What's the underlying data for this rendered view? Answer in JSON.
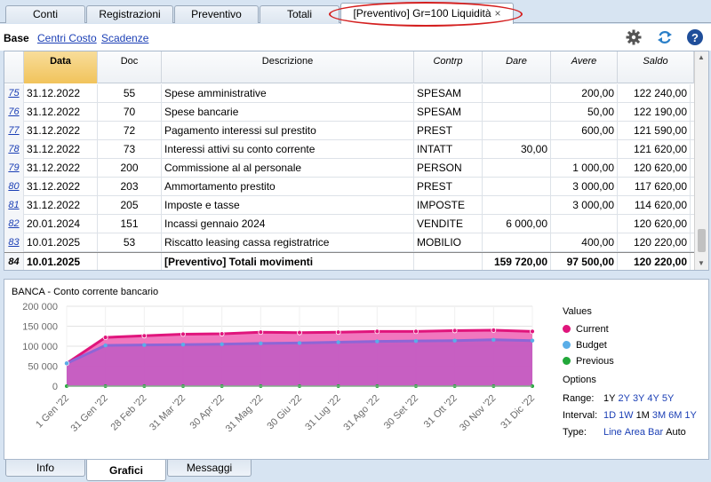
{
  "tabs": [
    {
      "label": "Conti"
    },
    {
      "label": "Registrazioni"
    },
    {
      "label": "Preventivo"
    },
    {
      "label": "Totali"
    },
    {
      "label": "[Preventivo] Gr=100 Liquidità",
      "close": "×"
    }
  ],
  "toolbar": {
    "base": "Base",
    "centri_costo": "Centri Costo",
    "scadenze": "Scadenze",
    "icons": [
      "gear-icon",
      "refresh-icon",
      "help-icon"
    ]
  },
  "table": {
    "columns": [
      "Data",
      "Doc",
      "Descrizione",
      "Contrp",
      "Dare",
      "Avere",
      "Saldo"
    ],
    "rows": [
      {
        "rn": "75",
        "date": "31.12.2022",
        "doc": "55",
        "desc": "Spese amministrative",
        "ctr": "SPESAM",
        "dare": "",
        "avere": "200,00",
        "saldo": "122 240,00"
      },
      {
        "rn": "76",
        "date": "31.12.2022",
        "doc": "70",
        "desc": "Spese bancarie",
        "ctr": "SPESAM",
        "dare": "",
        "avere": "50,00",
        "saldo": "122 190,00"
      },
      {
        "rn": "77",
        "date": "31.12.2022",
        "doc": "72",
        "desc": "Pagamento interessi sul prestito",
        "ctr": "PREST",
        "dare": "",
        "avere": "600,00",
        "saldo": "121 590,00"
      },
      {
        "rn": "78",
        "date": "31.12.2022",
        "doc": "73",
        "desc": "Interessi attivi su conto corrente",
        "ctr": "INTATT",
        "dare": "30,00",
        "avere": "",
        "saldo": "121 620,00"
      },
      {
        "rn": "79",
        "date": "31.12.2022",
        "doc": "200",
        "desc": "Commissione al al personale",
        "ctr": "PERSON",
        "dare": "",
        "avere": "1 000,00",
        "saldo": "120 620,00"
      },
      {
        "rn": "80",
        "date": "31.12.2022",
        "doc": "203",
        "desc": "Ammortamento prestito",
        "ctr": "PREST",
        "dare": "",
        "avere": "3 000,00",
        "saldo": "117 620,00"
      },
      {
        "rn": "81",
        "date": "31.12.2022",
        "doc": "205",
        "desc": "Imposte e tasse",
        "ctr": "IMPOSTE",
        "dare": "",
        "avere": "3 000,00",
        "saldo": "114 620,00"
      },
      {
        "rn": "82",
        "date": "20.01.2024",
        "doc": "151",
        "desc": "Incassi gennaio 2024",
        "ctr": "VENDITE",
        "dare": "6 000,00",
        "avere": "",
        "saldo": "120 620,00"
      },
      {
        "rn": "83",
        "date": "10.01.2025",
        "doc": "53",
        "desc": "Riscatto leasing cassa registratrice",
        "ctr": "MOBILIO",
        "dare": "",
        "avere": "400,00",
        "saldo": "120 220,00"
      }
    ],
    "total": {
      "rn": "84",
      "date": "10.01.2025",
      "doc": "",
      "desc": "[Preventivo] Totali movimenti",
      "ctr": "",
      "dare": "159 720,00",
      "avere": "97 500,00",
      "saldo": "120 220,00"
    }
  },
  "chart_data": {
    "type": "area",
    "title": "BANCA - Conto corrente bancario",
    "categories": [
      "1 Gen '22",
      "31 Gen '22",
      "28 Feb '22",
      "31 Mar '22",
      "30 Apr '22",
      "31 Mag '22",
      "30 Giu '22",
      "31 Lug '22",
      "31 Ago '22",
      "30 Set '22",
      "31 Ott '22",
      "30 Nov '22",
      "31 Dic '22"
    ],
    "ylim": [
      0,
      200000
    ],
    "yticks": [
      "200 000",
      "150 000",
      "100 000",
      "50 000",
      "0"
    ],
    "series": [
      {
        "name": "Current",
        "color": "#e0157c",
        "values": [
          57000,
          122000,
          126000,
          130000,
          131000,
          135000,
          134000,
          135000,
          137000,
          137000,
          139000,
          140000,
          137000
        ]
      },
      {
        "name": "Budget",
        "color": "#5aaee8",
        "values": [
          57000,
          102000,
          103000,
          104000,
          105000,
          107000,
          108000,
          110000,
          112000,
          113000,
          114000,
          116000,
          114000
        ]
      },
      {
        "name": "Previous",
        "color": "#22a83a",
        "values": [
          0,
          0,
          0,
          0,
          0,
          0,
          0,
          0,
          0,
          0,
          0,
          0,
          0
        ]
      }
    ]
  },
  "legend": {
    "title": "Values"
  },
  "options": {
    "title": "Options",
    "range_label": "Range:",
    "range": [
      "1Y",
      "2Y",
      "3Y",
      "4Y",
      "5Y"
    ],
    "range_selected": "1Y",
    "interval_label": "Interval:",
    "interval": [
      "1D",
      "1W",
      "1M",
      "3M",
      "6M",
      "1Y"
    ],
    "interval_selected": "1M",
    "type_label": "Type:",
    "type": [
      "Line",
      "Area",
      "Bar",
      "Auto"
    ],
    "type_selected": "Auto"
  },
  "bottom_tabs": [
    {
      "label": "Info"
    },
    {
      "label": "Grafici"
    },
    {
      "label": "Messaggi"
    }
  ]
}
